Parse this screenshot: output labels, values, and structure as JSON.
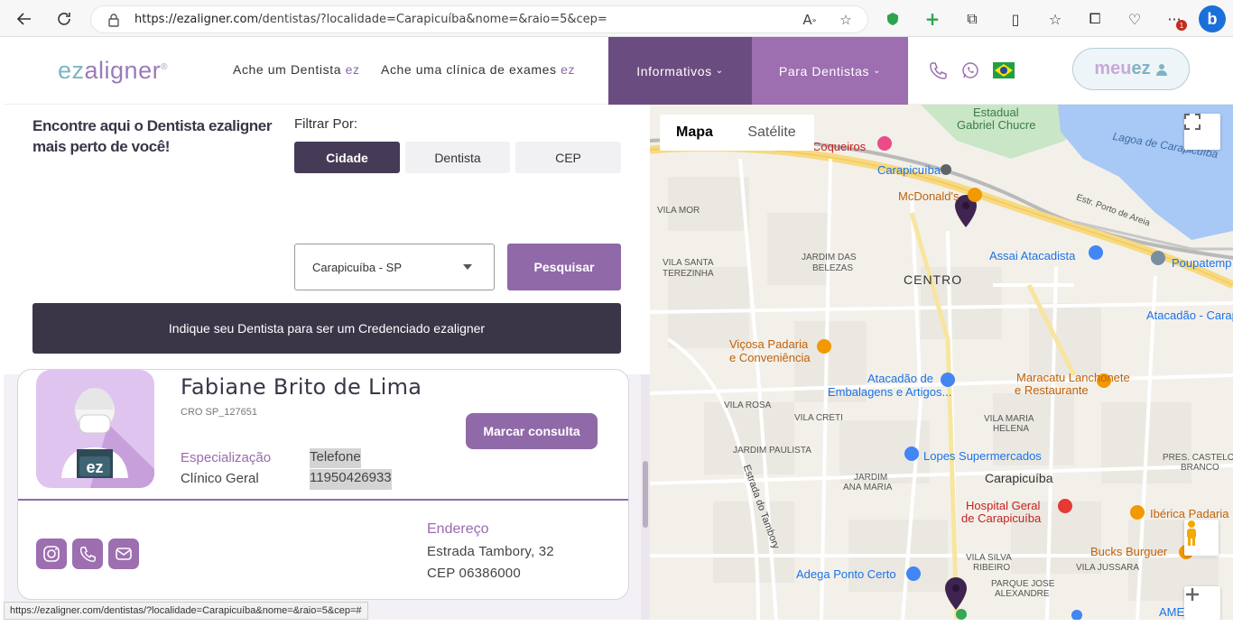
{
  "browser": {
    "url_host": "https://ezaligner.com",
    "url_path": "/dentistas/?localidade=Carapicuíba&nome=&raio=5&cep=",
    "status_url": "https://ezaligner.com/dentistas/?localidade=Carapicuíba&nome=&raio=5&cep=#",
    "notification_count": "1"
  },
  "header": {
    "logo_part1": "ez",
    "logo_part2": "aligner",
    "logo_reg": "®",
    "nav": [
      {
        "label": "Ache um Dentista ",
        "ez": "ez"
      },
      {
        "label": "Ache uma clínica de exames ",
        "ez": "ez"
      }
    ],
    "dropdowns": [
      {
        "label": "Informativos",
        "color": "#6b4c80"
      },
      {
        "label": "Para Dentistas",
        "color": "#9d6eb0"
      }
    ],
    "account_meu": "meu",
    "account_ez": "ez"
  },
  "search_panel": {
    "title": "Encontre aqui o Dentista ezaligner mais perto de você!",
    "filter_label": "Filtrar Por:",
    "filters": [
      "Cidade",
      "Dentista",
      "CEP"
    ],
    "active_filter": "Cidade",
    "city_value": "Carapicuíba - SP",
    "search_button": "Pesquisar",
    "indique_button": "Indique seu Dentista para ser um Credenciado ezaligner"
  },
  "result": {
    "name": "Fabiane Brito de Lima",
    "cro": "CRO SP_127651",
    "spec_label": "Especialização",
    "spec_value": "Clínico Geral",
    "phone_label": "Telefone",
    "phone_value": "11950426933",
    "book_button": "Marcar consulta",
    "address_label": "Endereço",
    "address_line1": "Estrada Tambory, 32",
    "address_line2": "CEP 06386000",
    "avatar_badge": "ez"
  },
  "map": {
    "tab_map": "Mapa",
    "tab_satellite": "Satélite",
    "labels": {
      "estadual": "Estadual",
      "gabriel": "Gabriel Chucre",
      "lagoa": "Lagoa de Carapicuíba",
      "hotel": "Hotel Coqueiros",
      "carapicuiba_station": "Carapicuíba",
      "mcdonalds": "McDonald's",
      "vila_mor": "VILA MOR",
      "estr_porto": "Estr. Porto de Areia",
      "vila_santa": "VILA SANTA",
      "terezinha": "TEREZINHA",
      "jardim_das": "JARDIM DAS",
      "belezas": "BELEZAS",
      "centro": "CENTRO",
      "assai": "Assai Atacadista",
      "poupatempo": "Poupatemp",
      "atacadao_cara": "Atacadão - Carap",
      "vicosa1": "Viçosa Padaria",
      "vicosa2": "e Conveniência",
      "atacadao_emb1": "Atacadão de",
      "atacadao_emb2": "Embalagens e Artigos...",
      "maracatu1": "Maracatu Lanchonete",
      "maracatu2": "e Restaurante",
      "vila_rosa": "VILA ROSA",
      "vila_creti": "VILA CRETI",
      "vila_maria": "VILA MARIA",
      "helena": "HELENA",
      "jardim_paulista": "JARDIM PAULISTA",
      "lopes": "Lopes Supermercados",
      "pres1": "PRES. CASTELO",
      "pres2": "BRANCO",
      "estrada_tambory": "Estrada do Tambory",
      "jardim_ana1": "JARDIM",
      "jardim_ana2": "ANA MARIA",
      "carapicuiba_city": "Carapicuíba",
      "hospital1": "Hospital Geral",
      "hospital2": "de Carapicuíba",
      "iberica": "Ibérica Padaria",
      "bucks": "Bucks Burguer",
      "vila_silva1": "VILA SILVA",
      "vila_silva2": "RIBEIRO",
      "vila_jussara": "VILA JUSSARA",
      "adega": "Adega Ponto Certo",
      "parque1": "PARQUE JOSE",
      "parque2": "ALEXANDRE",
      "ame": "AME Ca"
    }
  }
}
